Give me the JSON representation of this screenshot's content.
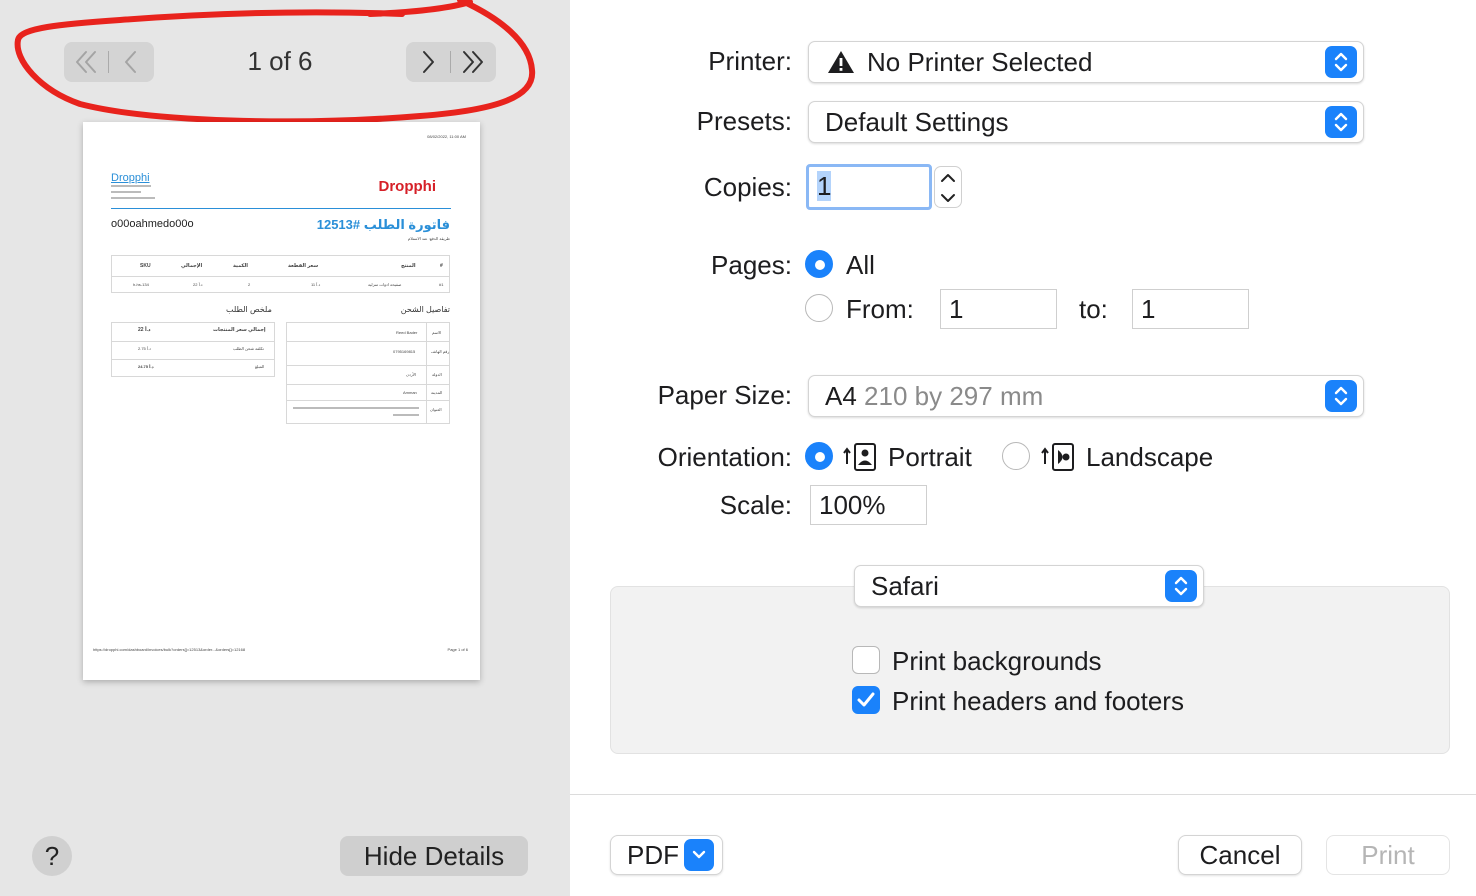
{
  "preview": {
    "page_indicator": "1 of 6",
    "help_label": "?",
    "hide_details_label": "Hide Details",
    "thumbnail": {
      "timestamp": "08/02/2022, 11:00 AM",
      "store_link": "Dropphi",
      "logo_text": "Dropphi",
      "customer_name": "o00oahmedo00o",
      "invoice_title": "فاتورة الطلب #12513",
      "payment_method": "طريقة الدفع: عند الاستلام",
      "table_headers": [
        "SKU",
        "الإجمالي",
        "الكمية",
        "سعر القطعة",
        "المنتج",
        "#"
      ],
      "table_row": [
        "h-hs-134",
        "22 د.أ",
        "2",
        "11 د.أ",
        "صفيحة ادوات منزلية",
        "#1"
      ],
      "summary_title": "ملخص الطلب",
      "shipping_title": "تفاصيل الشحن",
      "summary_rows": [
        [
          "22 د.أ",
          "إجمالي سعر المنتجات"
        ],
        [
          "2.75 د.أ",
          "تكلفة شحن الطلب"
        ],
        [
          "24.75 د.أ",
          "المبلغ"
        ]
      ],
      "shipping_rows": [
        [
          "Reed Bader",
          "الاسم"
        ],
        [
          "0795169815",
          "رقم الهاتف"
        ],
        [
          "الأردن",
          "الدولة"
        ],
        [
          "Amman",
          "المدينة"
        ],
        [
          "",
          "العنوان"
        ]
      ],
      "footer_url": "https://dropphi.com/dashboard/invoices/bulk?orders[]=12513&order...&orders[]=12168",
      "footer_page": "Page 1 of 6"
    }
  },
  "settings": {
    "printer": {
      "label": "Printer:",
      "value": "No Printer Selected"
    },
    "presets": {
      "label": "Presets:",
      "value": "Default Settings"
    },
    "copies": {
      "label": "Copies:",
      "value": "1"
    },
    "pages": {
      "label": "Pages:",
      "all_label": "All",
      "from_label": "From:",
      "from_value": "1",
      "to_label": "to:",
      "to_value": "1",
      "selected": "all"
    },
    "paper_size": {
      "label": "Paper Size:",
      "value": "A4",
      "detail": "210 by 297 mm"
    },
    "orientation": {
      "label": "Orientation:",
      "portrait_label": "Portrait",
      "landscape_label": "Landscape",
      "selected": "portrait"
    },
    "scale": {
      "label": "Scale:",
      "value": "100%"
    },
    "app_section": {
      "value": "Safari",
      "print_backgrounds": {
        "label": "Print backgrounds",
        "checked": false
      },
      "print_headers_footers": {
        "label": "Print headers and footers",
        "checked": true
      }
    }
  },
  "footer": {
    "pdf_label": "PDF",
    "cancel_label": "Cancel",
    "print_label": "Print"
  },
  "colors": {
    "accent": "#1a82fb",
    "annotation": "#e8231d",
    "logo_red": "#d62028",
    "link_blue": "#2a8fd8"
  }
}
